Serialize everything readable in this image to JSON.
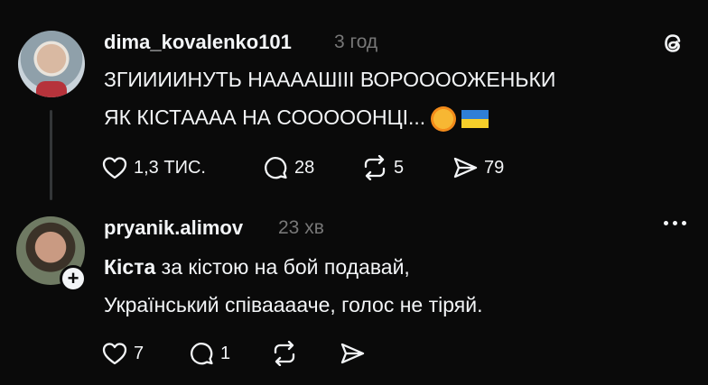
{
  "post": {
    "username": "dima_kovalenko101",
    "time": "3 год",
    "line1": "ЗГИИИИНУТЬ НАААAШІІІ ВОРООООЖЕНЬКИ",
    "line2": "ЯК КІСТАААА НА СООООOНЦІ...",
    "emoji_sun": "sun-emoji",
    "emoji_flag": "ukraine-flag-emoji",
    "likes": "1,3 ТИС.",
    "comments": "28",
    "reposts": "5",
    "shares": "79"
  },
  "reply": {
    "username": "pryanik.alimov",
    "time": "23 хв",
    "line1_bold": "Кіста",
    "line1_rest": " за кістою на бой подавай,",
    "line2": "Український співааааче,  голос не тіряй.",
    "likes": "7",
    "comments": "1",
    "plus": "+"
  },
  "icons": {
    "app": "threads-logo-icon",
    "like": "heart-icon",
    "comment": "comment-bubble-icon",
    "repost": "repost-icon",
    "share": "send-icon",
    "more": "more-dots-icon"
  }
}
